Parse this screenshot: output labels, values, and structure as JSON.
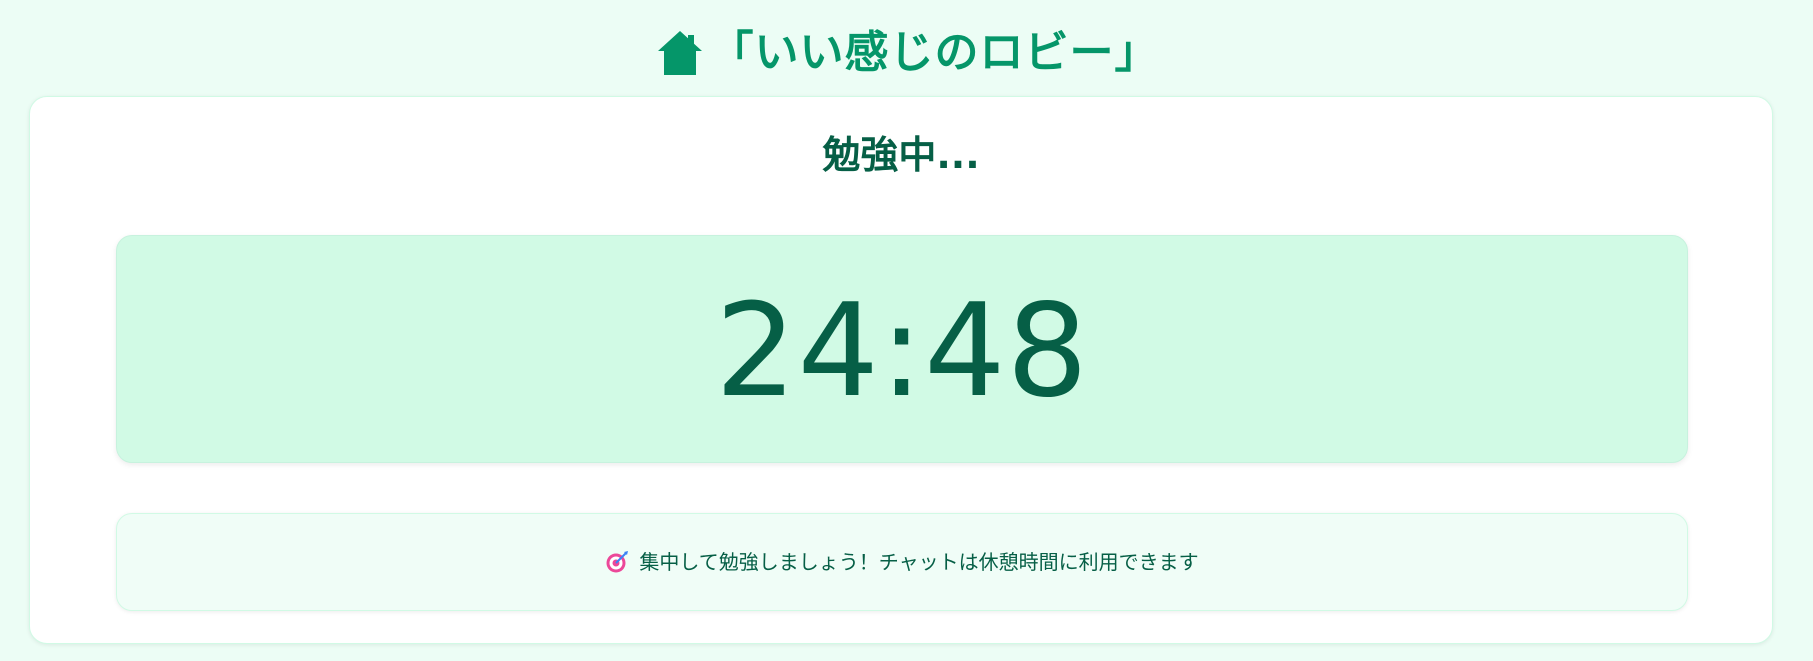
{
  "app": {
    "title": "「いい感じのロビー」",
    "icon": "home-icon"
  },
  "study": {
    "status": "勉強中...",
    "timer": "24:48",
    "notice_icon": "target-icon",
    "notice": "集中して勉強しましょう！チャットは休憩時間に利用できます"
  },
  "colors": {
    "accent": "#059669",
    "text_dark": "#065f46",
    "background": "#ecfdf5",
    "timer_panel": "#d1fae5",
    "notice_panel": "#f0fdf7"
  }
}
